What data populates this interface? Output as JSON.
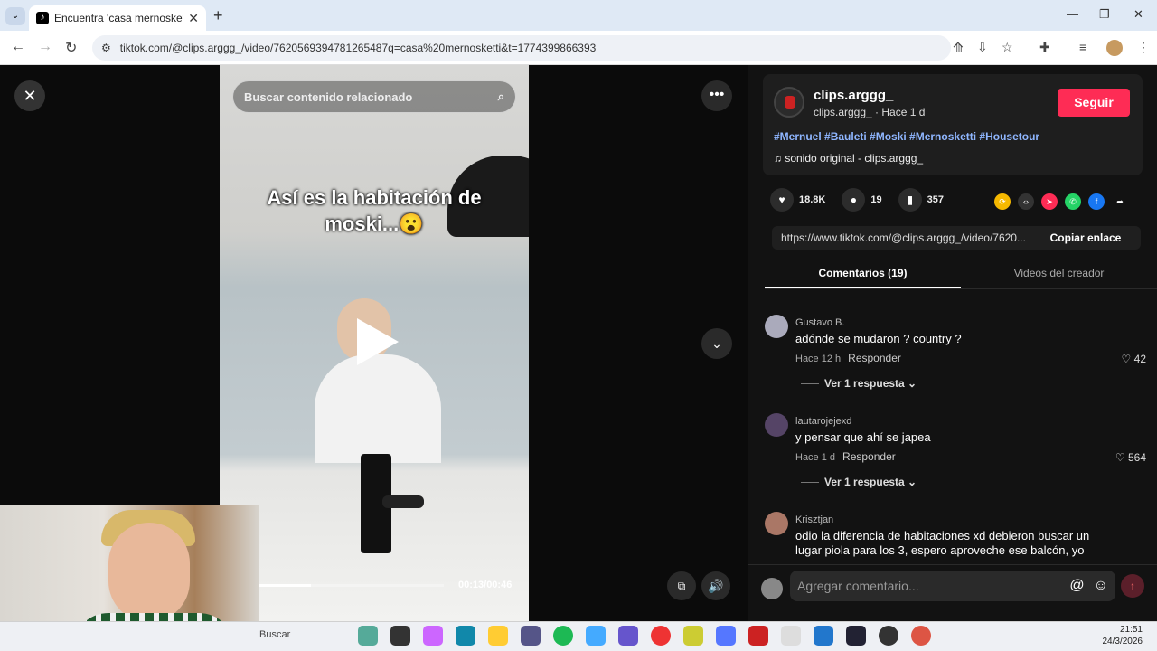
{
  "browser": {
    "tab_title": "Encuentra 'casa mernosketti' en",
    "new_tab": "+",
    "url": "tiktok.com/@clips.arggg_/video/7620569394781265487q=casa%20mernosketti&t=1774399866393"
  },
  "video": {
    "search_placeholder": "Buscar contenido relacionado",
    "caption_line1": "Así es la habitación de",
    "caption_line2": "moski...😮",
    "time": "00:13/00:46",
    "progress": 0.28
  },
  "author": {
    "name": "clips.arggg_",
    "sub": "clips.arggg_ · Hace 1 d",
    "follow_label": "Seguir",
    "hashtags": "#Mernuel #Bauleti #Moski #Mernosketti #Housetour",
    "sound": "♫  sonido original - clips.arggg_"
  },
  "stats": {
    "likes": "18.8K",
    "comments": "19",
    "saves": "357"
  },
  "share": {
    "link": "https://www.tiktok.com/@clips.arggg_/video/7620...",
    "copy_label": "Copiar enlace"
  },
  "tabs": {
    "comments": "Comentarios (19)",
    "creator": "Videos del creador"
  },
  "comments": [
    {
      "user": "Gustavo B.",
      "text": "adónde se mudaron ? country ?",
      "time": "Hace 12 h",
      "reply": "Responder",
      "likes": "42",
      "more": "Ver 1 respuesta ⌄"
    },
    {
      "user": "lautarojejexd",
      "text": "y pensar que ahí se japea",
      "time": "Hace 1 d",
      "reply": "Responder",
      "likes": "564",
      "more": "Ver 1 respuesta ⌄"
    },
    {
      "user": "Krisztjan",
      "text": "odio la diferencia de habitaciones xd debieron buscar un lugar piola para los 3, espero aproveche ese balcón, yo",
      "time": "",
      "reply": "",
      "likes": "",
      "more": ""
    }
  ],
  "add_comment": {
    "placeholder": "Agregar comentario..."
  },
  "taskbar": {
    "search": "Buscar",
    "time": "21:51",
    "date": "24/3/2026"
  }
}
